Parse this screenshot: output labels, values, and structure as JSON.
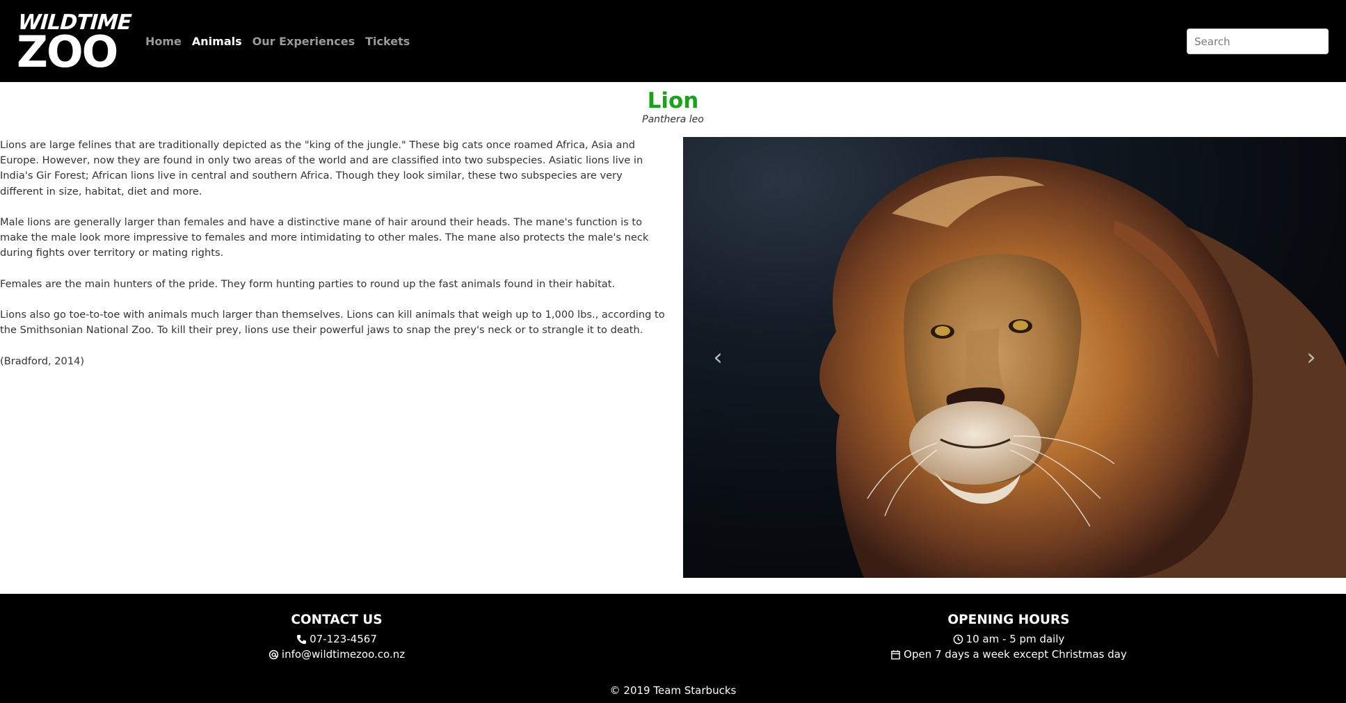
{
  "brand": {
    "line1": "WILDTIME",
    "line2": "ZOO"
  },
  "nav": {
    "items": [
      {
        "label": "Home",
        "active": false
      },
      {
        "label": "Animals",
        "active": true
      },
      {
        "label": "Our Experiences",
        "active": false
      },
      {
        "label": "Tickets",
        "active": false
      }
    ]
  },
  "search": {
    "placeholder": "Search",
    "value": ""
  },
  "animal": {
    "name": "Lion",
    "scientific_name": "Panthera leo",
    "name_color": "#1aa31a",
    "paragraphs": [
      "Lions are large felines that are traditionally depicted as the \"king of the jungle.\" These big cats once roamed Africa, Asia and Europe. However, now they are found in only two areas of the world and are classified into two subspecies. Asiatic lions live in India's Gir Forest; African lions live in central and southern Africa. Though they look similar, these two subspecies are very different in size, habitat, diet and more.",
      "Male lions are generally larger than females and have a distinctive mane of hair around their heads. The mane's function is to make the male look more impressive to females and more intimidating to other males. The mane also protects the male's neck during fights over territory or mating rights.",
      "Females are the main hunters of the pride. They form hunting parties to round up the fast animals found in their habitat.",
      "Lions also go toe-to-toe with animals much larger than themselves. Lions can kill animals that weigh up to 1,000 lbs., according to the Smithsonian National Zoo. To kill their prey, lions use their powerful jaws to snap the prey's neck or to strangle it to death.",
      "(Bradford, 2014)"
    ]
  },
  "carousel": {
    "prev_icon": "chevron-left-icon",
    "next_icon": "chevron-right-icon",
    "prev_glyph": "‹",
    "next_glyph": "›"
  },
  "footer": {
    "contact": {
      "heading": "CONTACT US",
      "phone": "07-123-4567",
      "email": "info@wildtimezoo.co.nz"
    },
    "hours": {
      "heading": "OPENING HOURS",
      "daily": "10 am - 5 pm daily",
      "days": "Open 7 days a week except Christmas day"
    },
    "copyright": "© 2019 Team Starbucks"
  }
}
